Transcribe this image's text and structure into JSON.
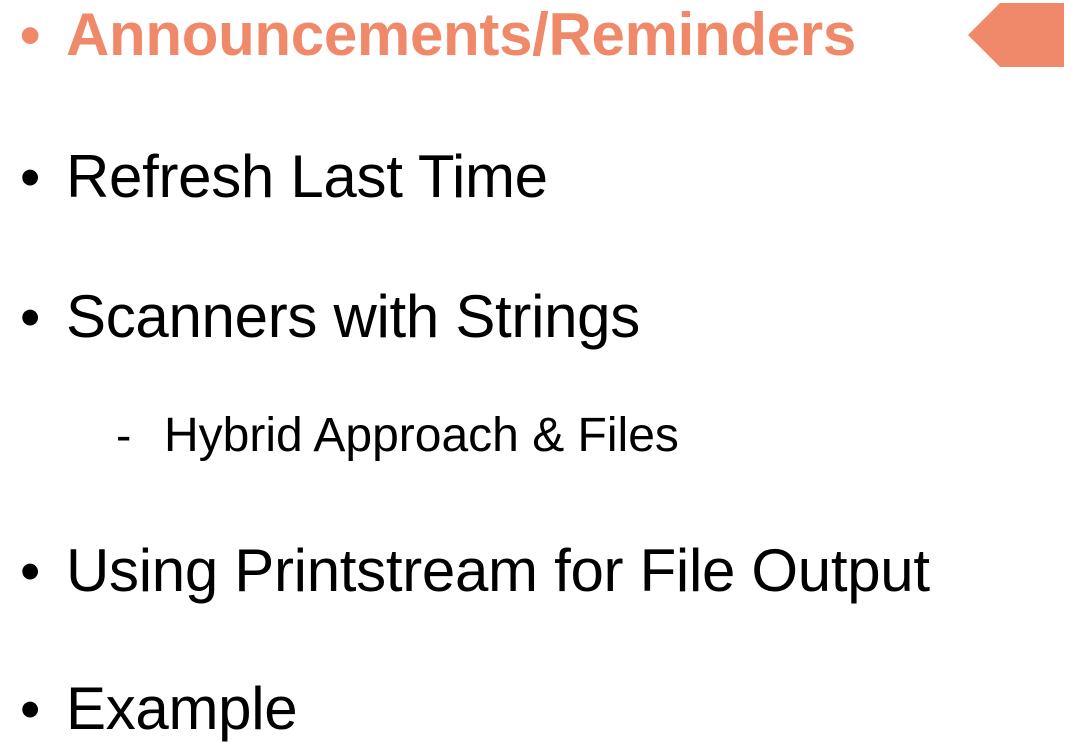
{
  "colors": {
    "accent": "#f0896a",
    "text": "#000000",
    "background": "#ffffff"
  },
  "bullets": [
    {
      "marker": "•",
      "text": "Announcements/Reminders",
      "current": true
    },
    {
      "marker": "•",
      "text": "Refresh Last Time"
    },
    {
      "marker": "•",
      "text": "Scanners with Strings"
    },
    {
      "marker": "-",
      "text": "Hybrid Approach & Files",
      "sub": true
    },
    {
      "marker": "•",
      "text": "Using Printstream for File Output"
    },
    {
      "marker": "•",
      "text": "Example"
    }
  ],
  "current_marker_icon": "arrow-left-pentagon-icon"
}
